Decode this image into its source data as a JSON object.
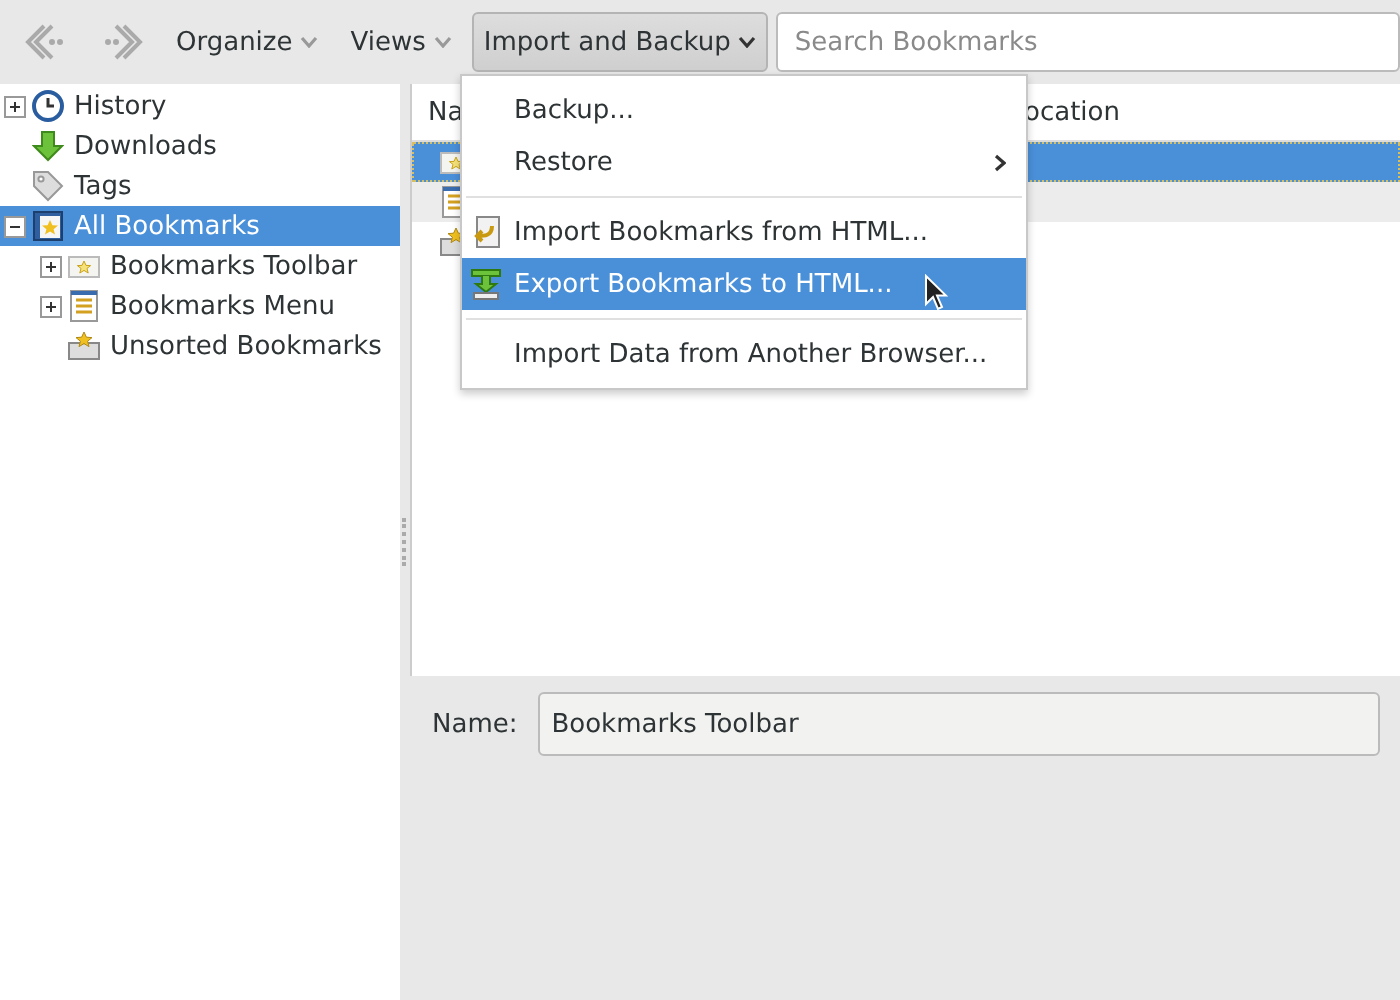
{
  "toolbar": {
    "menus": [
      {
        "label": "Organize",
        "open": false
      },
      {
        "label": "Views",
        "open": false
      },
      {
        "label": "Import and Backup",
        "open": true
      }
    ],
    "search": {
      "placeholder": "Search Bookmarks"
    }
  },
  "sidebar": {
    "items": [
      {
        "label": "History",
        "kind": "history",
        "expanded": false,
        "selected": false
      },
      {
        "label": "Downloads",
        "kind": "downloads",
        "selected": false
      },
      {
        "label": "Tags",
        "kind": "tags",
        "selected": false
      },
      {
        "label": "All Bookmarks",
        "kind": "all",
        "expanded": true,
        "selected": true,
        "children": [
          {
            "label": "Bookmarks Toolbar",
            "kind": "toolbar",
            "expanded": false,
            "selected": false
          },
          {
            "label": "Bookmarks Menu",
            "kind": "menu",
            "expanded": false,
            "selected": false
          },
          {
            "label": "Unsorted Bookmarks",
            "kind": "unsorted",
            "selected": false
          }
        ]
      }
    ]
  },
  "table": {
    "columns": [
      "Na",
      "ocation"
    ],
    "rows": [
      {
        "kind": "toolbar",
        "selected": true
      },
      {
        "kind": "menu",
        "selected": false
      },
      {
        "kind": "unsorted",
        "selected": false
      }
    ]
  },
  "menu": {
    "items": [
      {
        "kind": "plain",
        "label": "Backup...",
        "selected": false
      },
      {
        "kind": "submenu",
        "label": "Restore",
        "selected": false
      },
      {
        "kind": "separator"
      },
      {
        "kind": "import",
        "label": "Import Bookmarks from HTML...",
        "selected": false
      },
      {
        "kind": "export",
        "label": "Export Bookmarks to HTML...",
        "selected": true
      },
      {
        "kind": "separator"
      },
      {
        "kind": "plain",
        "label": "Import Data from Another Browser...",
        "selected": false
      }
    ]
  },
  "details": {
    "name_label": "Name:",
    "name_value": "Bookmarks Toolbar"
  }
}
